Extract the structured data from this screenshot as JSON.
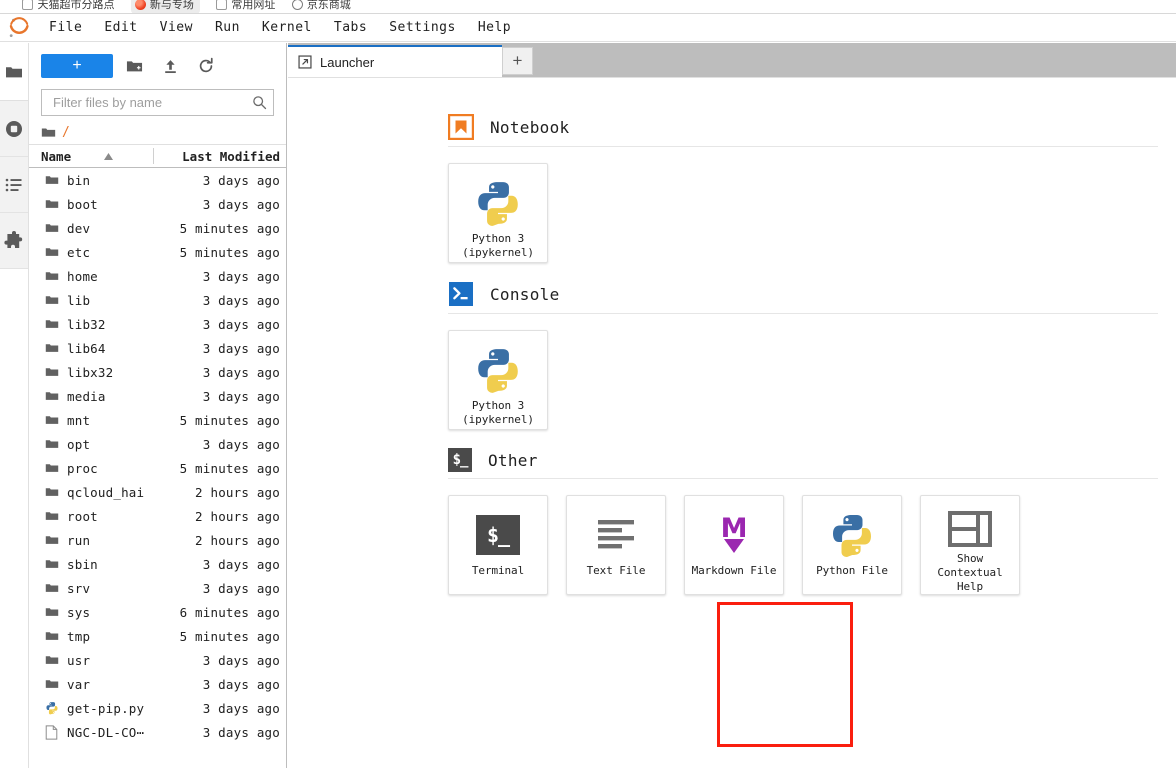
{
  "browser": {
    "bookmarks": [
      {
        "label": "天猫超市分路点",
        "icon": "bookmark-icon",
        "style": "plain"
      },
      {
        "label": "新与专场",
        "icon": "red-circle-icon",
        "style": "pill"
      },
      {
        "label": "常用网址",
        "icon": "bookmark-icon",
        "style": "plain"
      },
      {
        "label": "京东商城",
        "icon": "globe-icon",
        "style": "plain"
      }
    ]
  },
  "menubar": {
    "logo": "jupyter-logo",
    "items": [
      {
        "label": "File"
      },
      {
        "label": "Edit"
      },
      {
        "label": "View"
      },
      {
        "label": "Run"
      },
      {
        "label": "Kernel"
      },
      {
        "label": "Tabs"
      },
      {
        "label": "Settings"
      },
      {
        "label": "Help"
      }
    ]
  },
  "activitybar": {
    "items": [
      {
        "name": "file-browser-icon",
        "title": "File Browser",
        "active": true
      },
      {
        "name": "running-terminals-icon",
        "title": "Running Terminals and Kernels"
      },
      {
        "name": "commands-list-icon",
        "title": "Commands"
      },
      {
        "name": "extension-manager-icon",
        "title": "Extension Manager"
      }
    ]
  },
  "filebrowser": {
    "toolbar": {
      "new_launcher_label": "+",
      "new_folder_icon": "new-folder-icon",
      "upload_icon": "upload-icon",
      "refresh_icon": "refresh-icon"
    },
    "filter": {
      "placeholder": "Filter files by name",
      "value": "",
      "icon": "search-icon"
    },
    "breadcrumb": {
      "home_icon": "folder-icon",
      "root": "/"
    },
    "columns": {
      "name": "Name",
      "last_modified": "Last Modified",
      "sort_direction": "ascending"
    },
    "rows": [
      {
        "name": "bin",
        "modified": "3 days ago",
        "icon": "folder-icon"
      },
      {
        "name": "boot",
        "modified": "3 days ago",
        "icon": "folder-icon"
      },
      {
        "name": "dev",
        "modified": "5 minutes ago",
        "icon": "folder-icon"
      },
      {
        "name": "etc",
        "modified": "5 minutes ago",
        "icon": "folder-icon"
      },
      {
        "name": "home",
        "modified": "3 days ago",
        "icon": "folder-icon"
      },
      {
        "name": "lib",
        "modified": "3 days ago",
        "icon": "folder-icon"
      },
      {
        "name": "lib32",
        "modified": "3 days ago",
        "icon": "folder-icon"
      },
      {
        "name": "lib64",
        "modified": "3 days ago",
        "icon": "folder-icon"
      },
      {
        "name": "libx32",
        "modified": "3 days ago",
        "icon": "folder-icon"
      },
      {
        "name": "media",
        "modified": "3 days ago",
        "icon": "folder-icon"
      },
      {
        "name": "mnt",
        "modified": "5 minutes ago",
        "icon": "folder-icon"
      },
      {
        "name": "opt",
        "modified": "3 days ago",
        "icon": "folder-icon"
      },
      {
        "name": "proc",
        "modified": "5 minutes ago",
        "icon": "folder-icon"
      },
      {
        "name": "qcloud_hai",
        "modified": "2 hours ago",
        "icon": "folder-icon"
      },
      {
        "name": "root",
        "modified": "2 hours ago",
        "icon": "folder-icon"
      },
      {
        "name": "run",
        "modified": "2 hours ago",
        "icon": "folder-icon"
      },
      {
        "name": "sbin",
        "modified": "3 days ago",
        "icon": "folder-icon"
      },
      {
        "name": "srv",
        "modified": "3 days ago",
        "icon": "folder-icon"
      },
      {
        "name": "sys",
        "modified": "6 minutes ago",
        "icon": "folder-icon"
      },
      {
        "name": "tmp",
        "modified": "5 minutes ago",
        "icon": "folder-icon"
      },
      {
        "name": "usr",
        "modified": "3 days ago",
        "icon": "folder-icon"
      },
      {
        "name": "var",
        "modified": "3 days ago",
        "icon": "folder-icon"
      },
      {
        "name": "get-pip.py",
        "modified": "3 days ago",
        "icon": "python-file-icon"
      },
      {
        "name": "NGC-DL-CO⋯",
        "modified": "3 days ago",
        "icon": "text-file-icon"
      }
    ]
  },
  "dock": {
    "tabs": [
      {
        "label": "Launcher",
        "icon": "launcher-icon",
        "active": true
      }
    ],
    "add_tab_label": "+"
  },
  "launcher": {
    "sections": [
      {
        "title": "Notebook",
        "icon": "notebook-section-icon",
        "cards": [
          {
            "label": "Python 3\n(ipykernel)",
            "icon": "python-logo-icon"
          }
        ]
      },
      {
        "title": "Console",
        "icon": "console-section-icon",
        "cards": [
          {
            "label": "Python 3\n(ipykernel)",
            "icon": "python-logo-icon"
          }
        ]
      },
      {
        "title": "Other",
        "icon": "other-section-icon",
        "cards": [
          {
            "label": "Terminal",
            "icon": "terminal-icon",
            "highlighted": true
          },
          {
            "label": "Text File",
            "icon": "text-lines-icon"
          },
          {
            "label": "Markdown File",
            "icon": "markdown-icon"
          },
          {
            "label": "Python File",
            "icon": "python-logo-icon"
          },
          {
            "label": "Show Contextual\nHelp",
            "icon": "contextual-help-icon"
          }
        ]
      }
    ]
  },
  "annotation": {
    "target": "Terminal",
    "color": "#fa1e0e"
  },
  "colors": {
    "accent_blue": "#1a84e8",
    "tab_active_border": "#1a6fc4",
    "jupyter_orange": "#e8762c",
    "terminal_dark": "#4a4a4a",
    "markdown_purple": "#8e24aa",
    "annotation_red": "#fa1e0e"
  }
}
